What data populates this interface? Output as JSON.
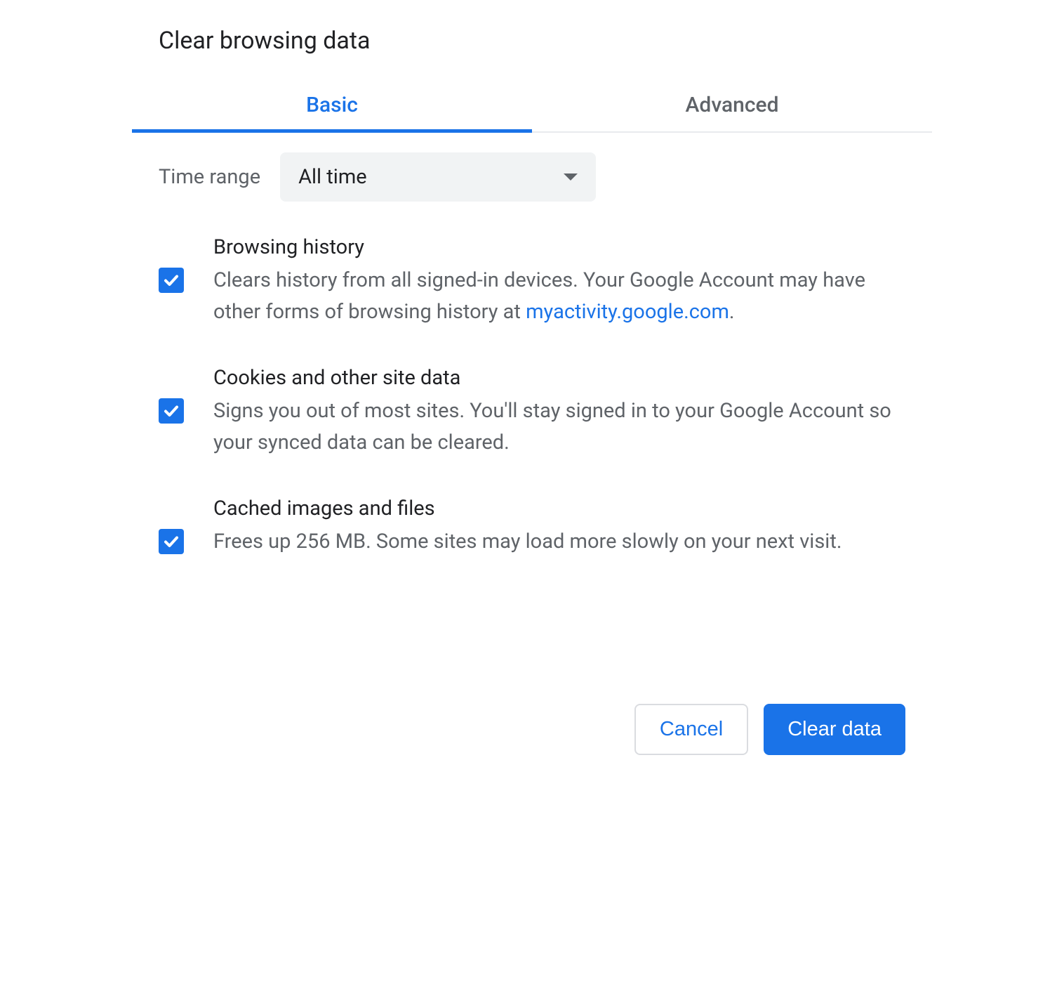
{
  "dialog": {
    "title": "Clear browsing data"
  },
  "tabs": {
    "basic": "Basic",
    "advanced": "Advanced"
  },
  "time_range": {
    "label": "Time range",
    "selected": "All time"
  },
  "options": {
    "browsing_history": {
      "title": "Browsing history",
      "desc_before": "Clears history from all signed-in devices. Your Google Account may have other forms of browsing history at ",
      "link_text": "myactivity.google.com",
      "desc_after": "."
    },
    "cookies": {
      "title": "Cookies and other site data",
      "desc": "Signs you out of most sites. You'll stay signed in to your Google Account so your synced data can be cleared."
    },
    "cache": {
      "title": "Cached images and files",
      "desc": "Frees up 256 MB. Some sites may load more slowly on your next visit."
    }
  },
  "buttons": {
    "cancel": "Cancel",
    "clear": "Clear data"
  }
}
